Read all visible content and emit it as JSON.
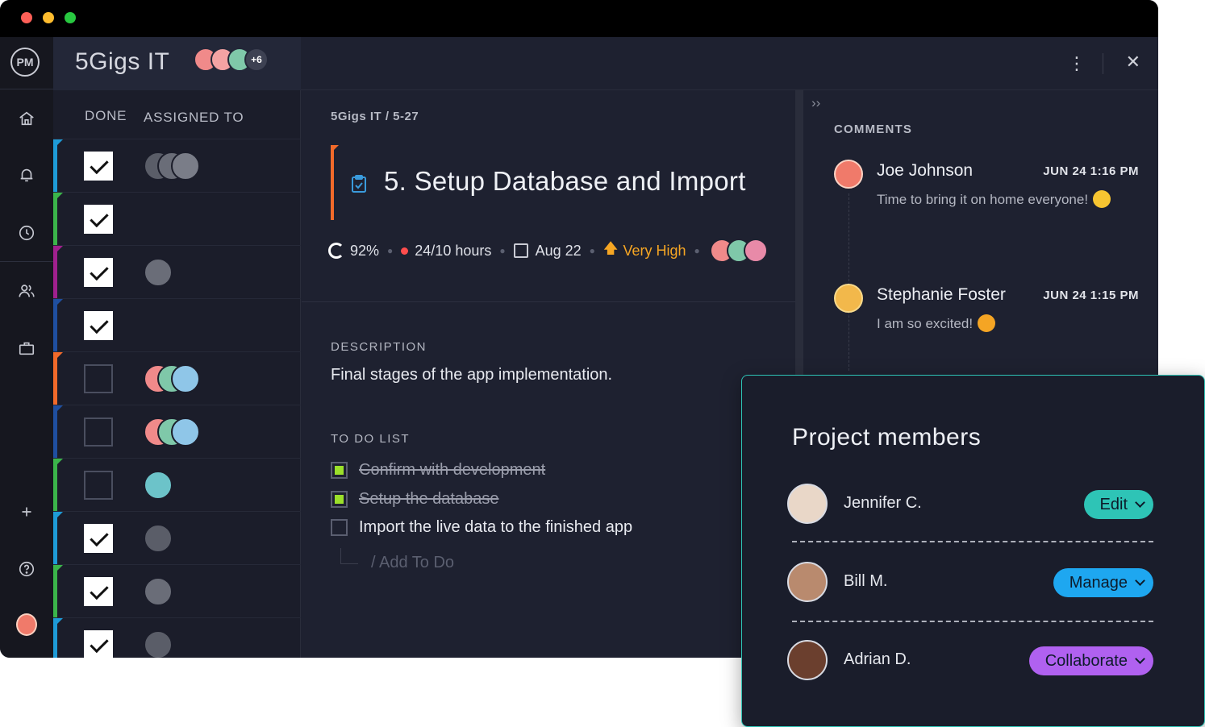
{
  "window": {
    "project_title": "5Gigs IT",
    "header_extra_count": "+6"
  },
  "rail": {
    "logo": "PM",
    "icons": [
      "home-icon",
      "bell-icon",
      "clock-icon",
      "users-icon",
      "briefcase-icon",
      "plus-icon",
      "help-icon",
      "avatar"
    ]
  },
  "list": {
    "col_done": "DONE",
    "col_assigned": "ASSIGNED TO",
    "rows": [
      {
        "done": true,
        "color": "#1e9bd7",
        "avatars": [
          "#5a5d68",
          "#6a6d78",
          "#7a7d88"
        ]
      },
      {
        "done": true,
        "color": "#3bb54a",
        "avatars": []
      },
      {
        "done": true,
        "color": "#a0208e",
        "avatars": [
          "#6a6d78"
        ]
      },
      {
        "done": true,
        "color": "#1f4fa0",
        "avatars": []
      },
      {
        "done": false,
        "color": "#f26a2a",
        "avatars": [
          "#f08a8a",
          "#7fc8a9",
          "#8fc6e8"
        ]
      },
      {
        "done": false,
        "color": "#1f4fa0",
        "avatars": [
          "#f08a8a",
          "#7fc8a9",
          "#8fc6e8"
        ]
      },
      {
        "done": false,
        "color": "#3bb54a",
        "avatars": [
          "#6cc3c9"
        ]
      },
      {
        "done": true,
        "color": "#1e9bd7",
        "avatars": [
          "#5a5d68"
        ]
      },
      {
        "done": true,
        "color": "#3bb54a",
        "avatars": [
          "#6a6d78"
        ]
      },
      {
        "done": true,
        "color": "#1e9bd7",
        "avatars": [
          "#5a5d68"
        ]
      }
    ]
  },
  "detail": {
    "breadcrumb": "5Gigs IT   /   5-27",
    "title": "5. Setup Database and Import",
    "progress": "92%",
    "hours": "24/10 hours",
    "date": "Aug 22",
    "priority": "Very High",
    "description_label": "DESCRIPTION",
    "description": "Final stages of the app implementation.",
    "todo_label": "TO DO LIST",
    "todos": [
      {
        "text": "Confirm with development",
        "done": true
      },
      {
        "text": "Setup the database",
        "done": true
      },
      {
        "text": "Import the live data to the finished app",
        "done": false
      }
    ],
    "add_todo": "/ Add To Do"
  },
  "comments": {
    "label": "COMMENTS",
    "items": [
      {
        "name": "Joe Johnson",
        "time": "JUN 24 1:16 PM",
        "text": "Time to bring it on home everyone!"
      },
      {
        "name": "Stephanie Foster",
        "time": "JUN 24 1:15 PM",
        "text": "I am so excited!"
      }
    ]
  },
  "members": {
    "title": "Project members",
    "list": [
      {
        "name": "Jennifer C.",
        "role": "Edit",
        "color": "#2ec4b6"
      },
      {
        "name": "Bill M.",
        "role": "Manage",
        "color": "#1ea7f0"
      },
      {
        "name": "Adrian D.",
        "role": "Collaborate",
        "color": "#b061f0"
      }
    ]
  }
}
